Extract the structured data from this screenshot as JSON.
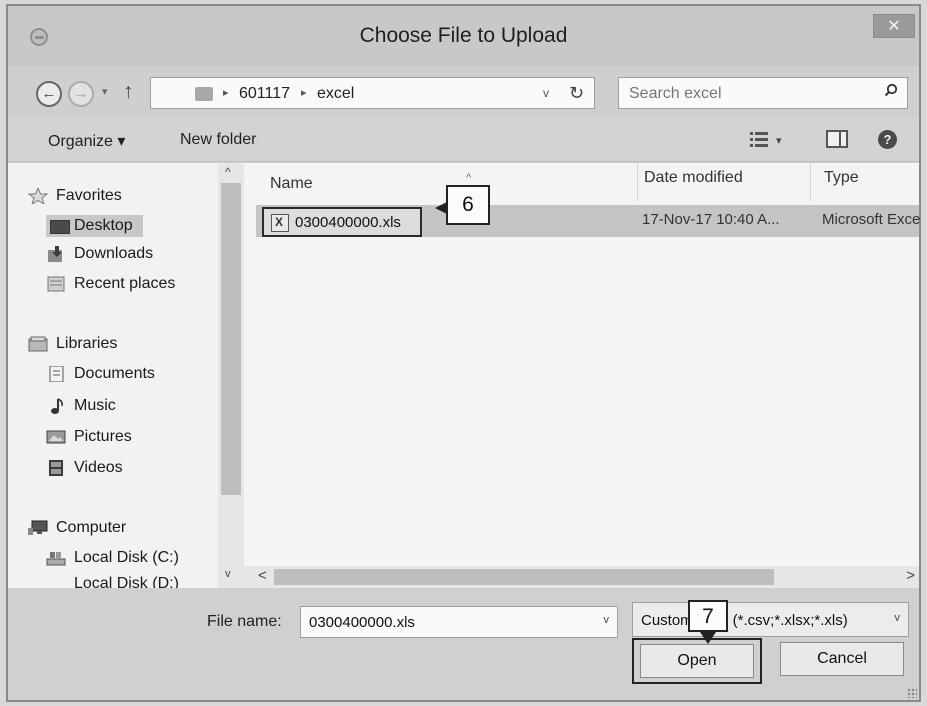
{
  "window": {
    "title": "Choose File to Upload",
    "close_label": "✕"
  },
  "navigation": {
    "back_glyph": "←",
    "forward_glyph": "→",
    "recent_glyph": "▾",
    "up_glyph": "↑",
    "breadcrumb": [
      "601117",
      "excel"
    ],
    "crumb_separator": "▸",
    "dropdown_glyph": "v",
    "refresh_glyph": "↻"
  },
  "search": {
    "placeholder": "Search excel"
  },
  "toolbar": {
    "organize_label": "Organize ▾",
    "new_folder_label": "New folder",
    "view_dropdown_glyph": "▾",
    "help_glyph": "?"
  },
  "sidebar": {
    "scroll_up_glyph": "^",
    "scroll_down_glyph": "v",
    "groups": [
      {
        "label": "Favorites",
        "icon": "star-icon",
        "items": [
          {
            "label": "Desktop",
            "icon": "desktop-icon",
            "selected": true
          },
          {
            "label": "Downloads",
            "icon": "downloads-icon"
          },
          {
            "label": "Recent places",
            "icon": "recent-places-icon"
          }
        ]
      },
      {
        "label": "Libraries",
        "icon": "libraries-icon",
        "items": [
          {
            "label": "Documents",
            "icon": "documents-icon"
          },
          {
            "label": "Music",
            "icon": "music-icon"
          },
          {
            "label": "Pictures",
            "icon": "pictures-icon"
          },
          {
            "label": "Videos",
            "icon": "videos-icon"
          }
        ]
      },
      {
        "label": "Computer",
        "icon": "computer-icon",
        "items": [
          {
            "label": "Local Disk (C:)",
            "icon": "disk-icon"
          },
          {
            "label": "Local Disk (D:)",
            "icon": "disk-icon"
          }
        ]
      }
    ]
  },
  "file_list": {
    "columns": [
      "Name",
      "Date modified",
      "Type"
    ],
    "sort_glyph": "^",
    "rows": [
      {
        "name": "0300400000.xls",
        "date": "17-Nov-17 10:40 A...",
        "type": "Microsoft Exce"
      }
    ],
    "hscroll_left": "<",
    "hscroll_right": ">"
  },
  "bottom": {
    "file_name_label": "File name:",
    "file_name_value": "0300400000.xls",
    "file_type_value": "Custom Files (*.csv;*.xlsx;*.xls)",
    "dropdown_glyph": "v",
    "open_label": "Open",
    "cancel_label": "Cancel"
  },
  "callouts": {
    "step_6": "6",
    "step_7": "7"
  }
}
